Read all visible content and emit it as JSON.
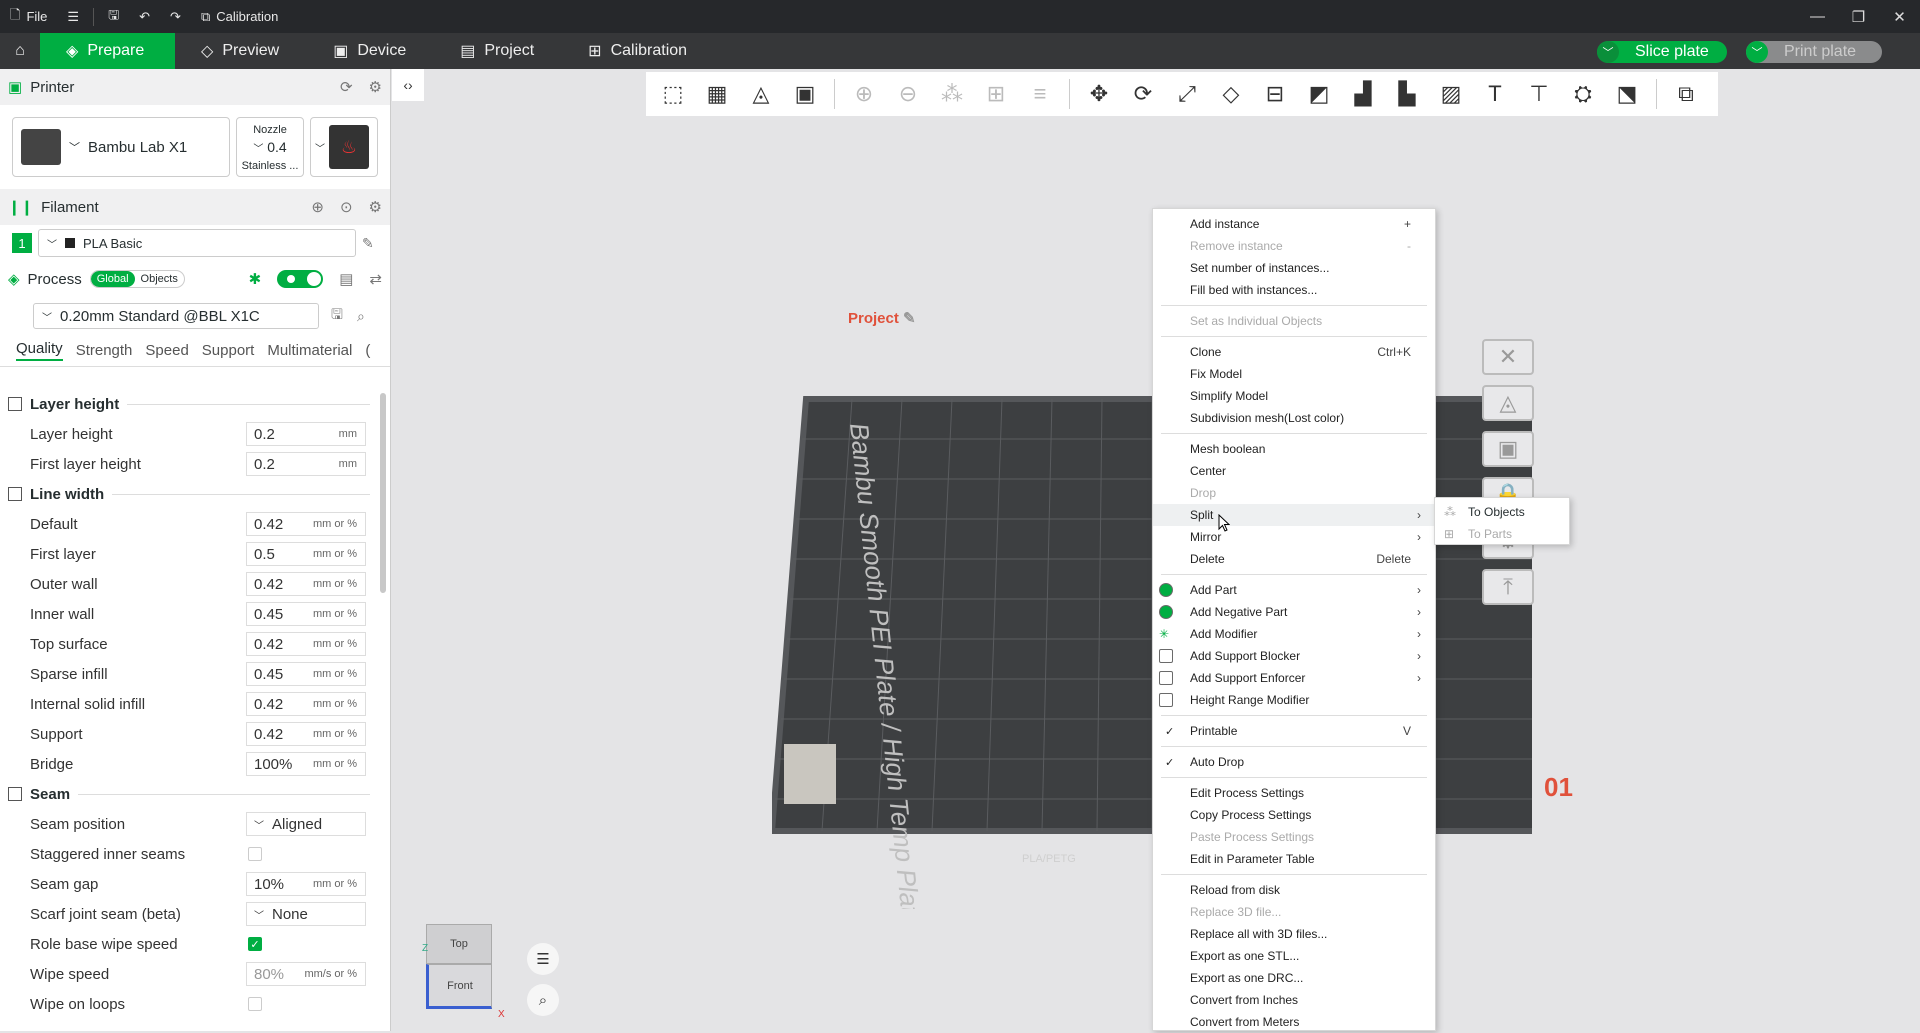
{
  "titlebar": {
    "file_label": "File",
    "calibration_label": "Calibration"
  },
  "nav": {
    "tabs": [
      {
        "label": "Prepare"
      },
      {
        "label": "Preview"
      },
      {
        "label": "Device"
      },
      {
        "label": "Project"
      },
      {
        "label": "Calibration"
      }
    ],
    "slice_label": "Slice plate",
    "print_label": "Print plate"
  },
  "printer": {
    "section_label": "Printer",
    "name": "Bambu Lab X1",
    "nozzle_label": "Nozzle",
    "nozzle_value": "0.4",
    "nozzle_type": "Stainless ..."
  },
  "filament": {
    "section_label": "Filament",
    "slot_number": "1",
    "name": "PLA Basic"
  },
  "process": {
    "section_label": "Process",
    "toggle_global": "Global",
    "toggle_objects": "Objects",
    "profile": "0.20mm Standard @BBL X1C",
    "tabs": [
      "Quality",
      "Strength",
      "Speed",
      "Support",
      "Multimaterial",
      "("
    ]
  },
  "params": {
    "layer_height_group": "Layer height",
    "layer_height": {
      "label": "Layer height",
      "value": "0.2",
      "unit": "mm"
    },
    "first_layer_height": {
      "label": "First layer height",
      "value": "0.2",
      "unit": "mm"
    },
    "line_width_group": "Line width",
    "default": {
      "label": "Default",
      "value": "0.42",
      "unit": "mm or %"
    },
    "first_layer": {
      "label": "First layer",
      "value": "0.5",
      "unit": "mm or %"
    },
    "outer_wall": {
      "label": "Outer wall",
      "value": "0.42",
      "unit": "mm or %"
    },
    "inner_wall": {
      "label": "Inner wall",
      "value": "0.45",
      "unit": "mm or %"
    },
    "top_surface": {
      "label": "Top surface",
      "value": "0.42",
      "unit": "mm or %"
    },
    "sparse_infill": {
      "label": "Sparse infill",
      "value": "0.45",
      "unit": "mm or %"
    },
    "internal_solid_infill": {
      "label": "Internal solid infill",
      "value": "0.42",
      "unit": "mm or %"
    },
    "support": {
      "label": "Support",
      "value": "0.42",
      "unit": "mm or %"
    },
    "bridge": {
      "label": "Bridge",
      "value": "100%",
      "unit": "mm or %"
    },
    "seam_group": "Seam",
    "seam_position": {
      "label": "Seam position",
      "value": "Aligned"
    },
    "staggered_inner_seams": {
      "label": "Staggered inner seams",
      "checked": false
    },
    "seam_gap": {
      "label": "Seam gap",
      "value": "10%",
      "unit": "mm or %"
    },
    "scarf_joint_seam": {
      "label": "Scarf joint seam (beta)",
      "value": "None"
    },
    "role_base_wipe_speed": {
      "label": "Role base wipe speed",
      "checked": true
    },
    "wipe_speed": {
      "label": "Wipe speed",
      "value": "80%",
      "unit": "mm/s or %"
    },
    "wipe_on_loops": {
      "label": "Wipe on loops",
      "checked": false
    }
  },
  "viewport": {
    "project_label": "Project",
    "plate_number": "01",
    "plate_text": "Bambu Smooth PEI Plate / High Temp Plate",
    "plate_tag": "PLA/PETG",
    "cube_top": "Top",
    "cube_front": "Front",
    "axis_x": "X",
    "axis_z": "Z"
  },
  "context_menu": {
    "items": [
      {
        "label": "Add instance",
        "shortcut": "+"
      },
      {
        "label": "Remove instance",
        "shortcut": "-",
        "disabled": true
      },
      {
        "label": "Set number of instances..."
      },
      {
        "label": "Fill bed with instances..."
      },
      {
        "label": "Set as Individual Objects",
        "disabled": true
      },
      {
        "label": "Clone",
        "shortcut": "Ctrl+K"
      },
      {
        "label": "Fix Model"
      },
      {
        "label": "Simplify Model"
      },
      {
        "label": "Subdivision mesh(Lost color)"
      },
      {
        "label": "Mesh boolean"
      },
      {
        "label": "Center"
      },
      {
        "label": "Drop",
        "disabled": true
      },
      {
        "label": "Split"
      },
      {
        "label": "Mirror"
      },
      {
        "label": "Delete",
        "shortcut": "Delete"
      },
      {
        "label": "Add Part"
      },
      {
        "label": "Add Negative Part"
      },
      {
        "label": "Add Modifier"
      },
      {
        "label": "Add Support Blocker"
      },
      {
        "label": "Add Support Enforcer"
      },
      {
        "label": "Height Range Modifier"
      },
      {
        "label": "Printable",
        "shortcut": "V"
      },
      {
        "label": "Auto Drop"
      },
      {
        "label": "Edit Process Settings"
      },
      {
        "label": "Copy Process Settings"
      },
      {
        "label": "Paste Process Settings",
        "disabled": true
      },
      {
        "label": "Edit in Parameter Table"
      },
      {
        "label": "Reload from disk"
      },
      {
        "label": "Replace 3D file...",
        "disabled": true
      },
      {
        "label": "Replace all with 3D files..."
      },
      {
        "label": "Export as one STL..."
      },
      {
        "label": "Export as one DRC..."
      },
      {
        "label": "Convert from Inches"
      },
      {
        "label": "Convert from Meters"
      }
    ],
    "submenu": [
      {
        "label": "To Objects"
      },
      {
        "label": "To Parts",
        "disabled": true
      }
    ]
  },
  "colors": {
    "accent": "#00ae42",
    "plate_label": "#e0513b",
    "bed": "#3d3f41"
  }
}
